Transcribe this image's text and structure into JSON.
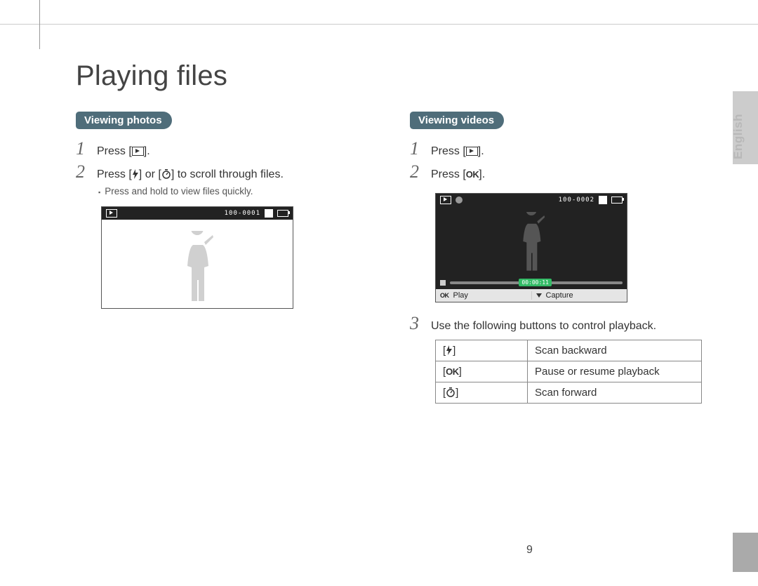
{
  "title": "Playing files",
  "language_tab": "English",
  "page_number": "9",
  "left": {
    "heading": "Viewing photos",
    "step1": {
      "num": "1",
      "prefix": "Press [",
      "suffix": "]."
    },
    "step2": {
      "num": "2",
      "t1": "Press [",
      "t2": "] or [",
      "t3": "] to scroll through files."
    },
    "sub_bullet": "Press and hold to view files quickly.",
    "lcd": {
      "file_counter": "100-0001"
    }
  },
  "right": {
    "heading": "Viewing videos",
    "step1": {
      "num": "1",
      "prefix": "Press [",
      "suffix": "]."
    },
    "step2": {
      "num": "2",
      "prefix": "Press [",
      "ok": "OK",
      "suffix": "]."
    },
    "lcd": {
      "file_counter": "100-0002",
      "timestamp": "00:00:11",
      "bottom_left_label": "Play",
      "bottom_left_key": "OK",
      "bottom_right_label": "Capture"
    },
    "step3": {
      "num": "3",
      "text": "Use the following buttons to control playback."
    },
    "table": {
      "row1_desc": "Scan backward",
      "row2_key": "OK",
      "row2_desc": "Pause or resume playback",
      "row3_desc": "Scan forward"
    }
  }
}
